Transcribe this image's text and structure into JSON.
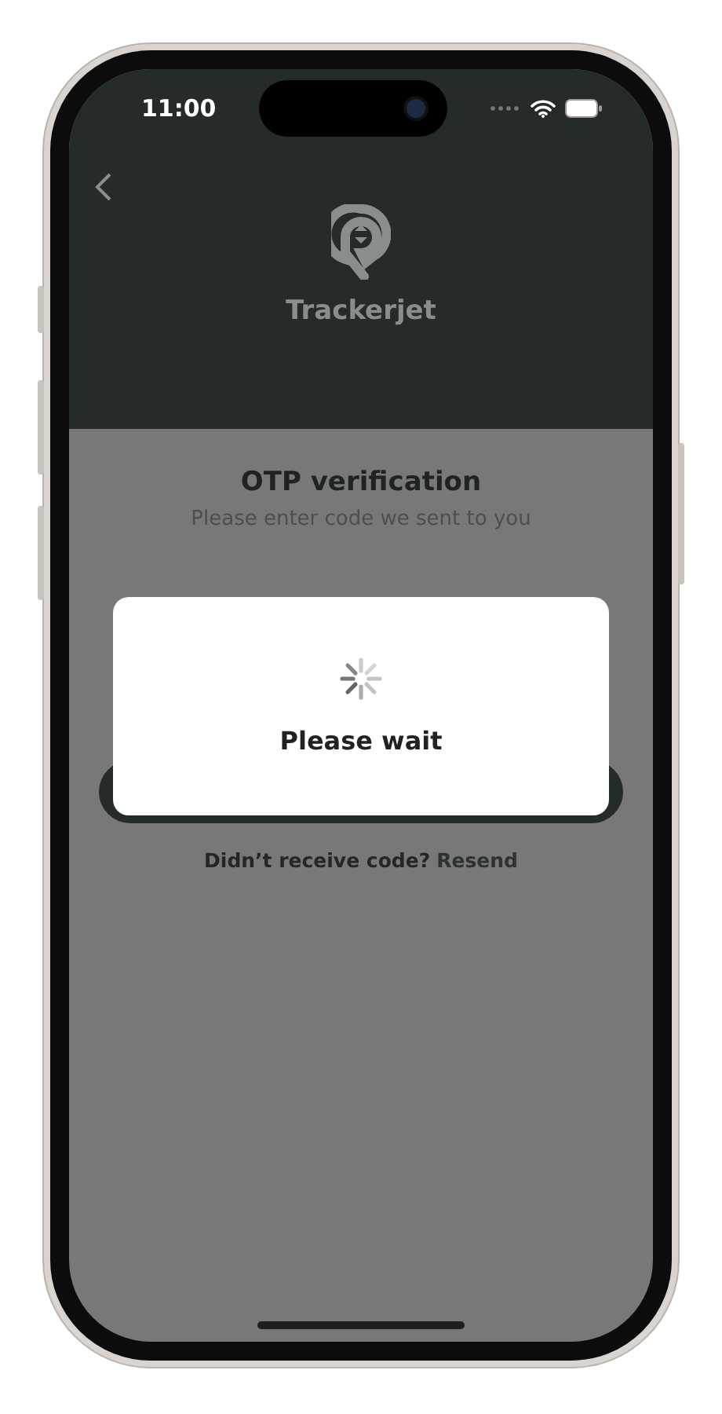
{
  "status_bar": {
    "time": "11:00"
  },
  "header": {
    "brand": "Trackerjet"
  },
  "otp": {
    "title": "OTP verification",
    "subtitle": "Please enter code we sent to you"
  },
  "resend_prompt": {
    "text": "Didn’t receive code?",
    "link": "Resend"
  },
  "dialog": {
    "message": "Please wait"
  }
}
